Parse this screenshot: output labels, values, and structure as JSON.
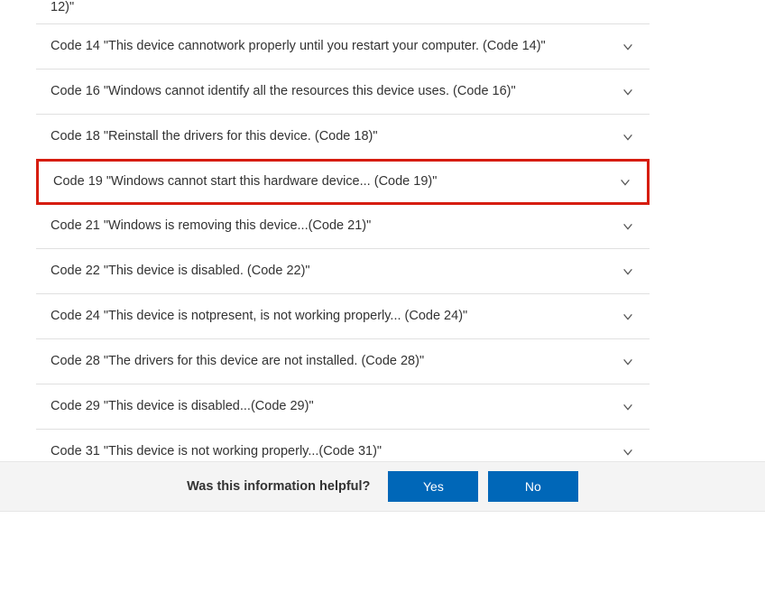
{
  "partial_top": "12)\"",
  "items": [
    {
      "label": "Code 14 \"This device cannotwork properly until you restart your computer. (Code 14)\"",
      "highlighted": false
    },
    {
      "label": "Code 16 \"Windows cannot identify all the resources this device uses. (Code 16)\"",
      "highlighted": false
    },
    {
      "label": "Code 18 \"Reinstall the drivers for this device. (Code 18)\"",
      "highlighted": false
    },
    {
      "label": "Code 19 \"Windows cannot start this hardware device... (Code 19)\"",
      "highlighted": true
    },
    {
      "label": "Code 21 \"Windows is removing this device...(Code 21)\"",
      "highlighted": false
    },
    {
      "label": "Code 22 \"This device is disabled. (Code 22)\"",
      "highlighted": false
    },
    {
      "label": "Code 24 \"This device is notpresent, is not working properly... (Code 24)\"",
      "highlighted": false
    },
    {
      "label": "Code 28 \"The drivers for this device are not installed. (Code 28)\"",
      "highlighted": false
    },
    {
      "label": "Code 29 \"This device is disabled...(Code 29)\"",
      "highlighted": false
    },
    {
      "label": "Code 31 \"This device is not working properly...(Code 31)\"",
      "highlighted": false
    }
  ],
  "feedback": {
    "prompt": "Was this information helpful?",
    "yes_label": "Yes",
    "no_label": "No"
  }
}
